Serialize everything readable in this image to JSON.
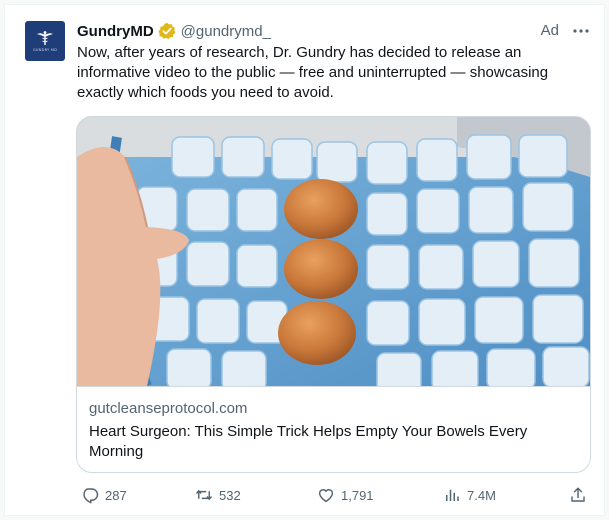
{
  "tweet": {
    "author_name": "GundryMD",
    "author_handle": "@gundrymd_",
    "avatar_text": "GUNDRY MD",
    "ad_label": "Ad",
    "text": "Now, after years of research, Dr. Gundry has decided to release an informative video to the public — free and uninterrupted — showcasing exactly which foods you need to avoid.",
    "card": {
      "domain": "gutcleanseprotocol.com",
      "title": "Heart Surgeon: This Simple Trick Helps Empty Your Bowels Every Morning"
    },
    "actions": {
      "replies": "287",
      "retweets": "532",
      "likes": "1,791",
      "views": "7.4M"
    }
  },
  "colors": {
    "brand_navy": "#1f3d78",
    "verified_gold": "#e2b719",
    "text_primary": "#0f1419",
    "text_secondary": "#536471",
    "border": "#cfd9de"
  },
  "icons": [
    "verified-badge-icon",
    "more-icon",
    "reply-icon",
    "retweet-icon",
    "like-icon",
    "views-icon",
    "share-icon"
  ]
}
